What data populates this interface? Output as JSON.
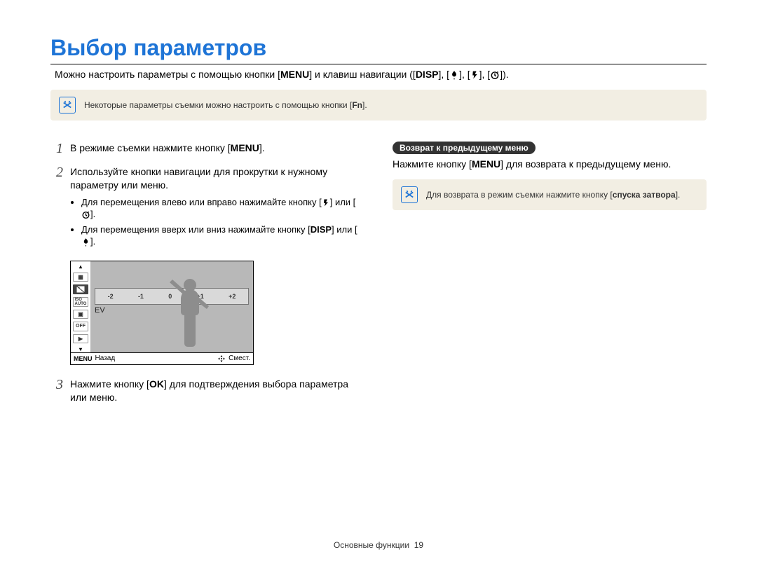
{
  "title": "Выбор параметров",
  "intro": {
    "part1": "Можно настроить параметры с помощью кнопки [",
    "menu": "MENU",
    "part2": "] и клавиш навигации ([",
    "disp": "DISP",
    "part3": "], [",
    "part4": "], [",
    "part5": "], [",
    "part6": "])."
  },
  "top_note": {
    "text_a": "Некоторые параметры съемки можно настроить с помощью кнопки [",
    "fn": "Fn",
    "text_b": "]."
  },
  "steps": {
    "s1": {
      "num": "1",
      "a": "В режиме съемки нажмите кнопку [",
      "menu": "MENU",
      "b": "]."
    },
    "s2": {
      "num": "2",
      "text": "Используйте кнопки навигации для прокрутки к нужному параметру или меню.",
      "b1a": "Для перемещения влево или вправо нажимайте кнопку [",
      "b1b": "] или [",
      "b1c": "].",
      "b2a": "Для перемещения вверх или вниз нажимайте кнопку [",
      "disp": "DISP",
      "b2b": "] или [",
      "b2c": "]."
    },
    "s3": {
      "num": "3",
      "a": "Нажмите кнопку [",
      "ok": "OK",
      "b": "] для подтверждения выбора параметра или меню."
    }
  },
  "screenshot": {
    "ev_ticks": [
      "-2",
      "-1",
      "0",
      "+1",
      "+2"
    ],
    "ev_label": "EV",
    "back": "Назад",
    "move": "Смест.",
    "menu": "MENU",
    "side": [
      "▲",
      "▦",
      "✱",
      "ISO",
      "▣",
      "☐",
      "▶",
      "▾"
    ],
    "iso_text": "ISO\nAUTO"
  },
  "right": {
    "badge": "Возврат к предыдущему меню",
    "a": "Нажмите кнопку [",
    "menu": "MENU",
    "b": "] для возврата к предыдущему меню.",
    "note_a": "Для возврата в режим съемки нажмите кнопку [",
    "note_bold": "спуска затвора",
    "note_b": "]."
  },
  "footer": {
    "label": "Основные функции",
    "page": "19"
  }
}
